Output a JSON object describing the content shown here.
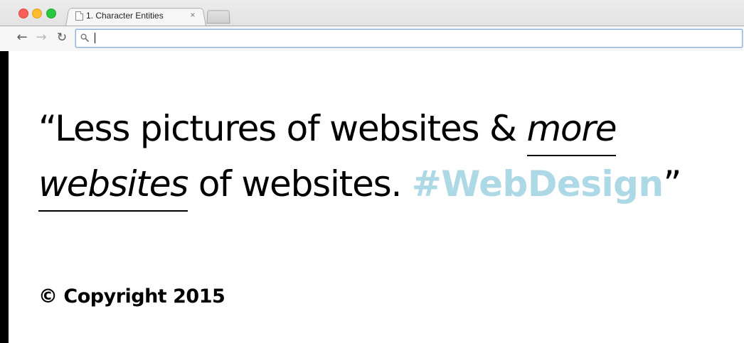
{
  "browser": {
    "tab": {
      "title": "1. Character Entities",
      "close_glyph": "×"
    },
    "nav": {
      "back_glyph": "←",
      "forward_glyph": "→",
      "reload_glyph": "↻"
    },
    "omnibox": {
      "value": "",
      "placeholder": ""
    },
    "icons": [
      "close-window-icon",
      "minimize-window-icon",
      "zoom-window-icon",
      "document-icon",
      "search-icon"
    ]
  },
  "content": {
    "open_quote": "“",
    "text_1": "Less pictures of websites & ",
    "em_1": "more",
    "space": " ",
    "em_2": "websites",
    "text_2": " of websites. ",
    "hashtag": "#WebDesign",
    "close_quote": "”",
    "copyright": "© Copyright 2015"
  },
  "colors": {
    "hashtag": "#add8e6",
    "text": "#000000",
    "page_background": "#ffffff",
    "side_border": "#000000"
  }
}
